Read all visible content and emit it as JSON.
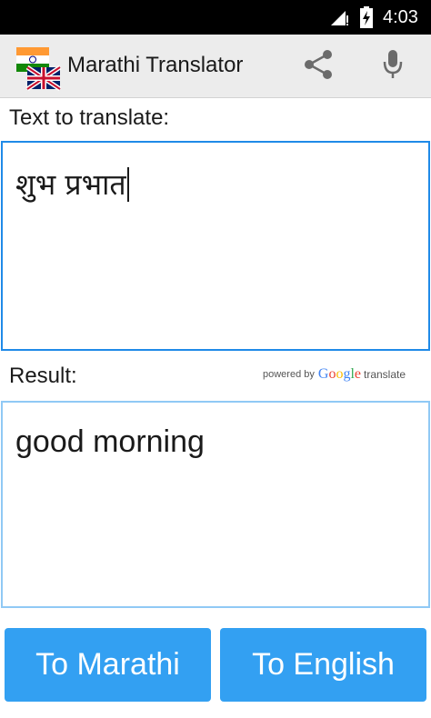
{
  "status": {
    "time": "4:03",
    "signal_icon": "signal-icon",
    "battery_icon": "battery-charging-icon"
  },
  "action_bar": {
    "title": "Marathi Translator",
    "app_icon": "india-uk-flags-icon",
    "share_icon": "share-icon",
    "mic_icon": "microphone-icon"
  },
  "input": {
    "label": "Text to translate:",
    "value": "शुभ प्रभात"
  },
  "result": {
    "label": "Result:",
    "value": "good morning",
    "powered_by": "powered by",
    "google_letters": [
      "G",
      "o",
      "o",
      "g",
      "l",
      "e"
    ],
    "translate": "translate"
  },
  "buttons": {
    "to_marathi": "To Marathi",
    "to_english": "To English"
  },
  "colors": {
    "accent": "#33a0f2",
    "input_border": "#1f8ae8",
    "result_border": "#90c9f5",
    "google_blue": "#4285f4",
    "google_red": "#ea4335",
    "google_yellow": "#fbbc05",
    "google_green": "#34a853"
  }
}
